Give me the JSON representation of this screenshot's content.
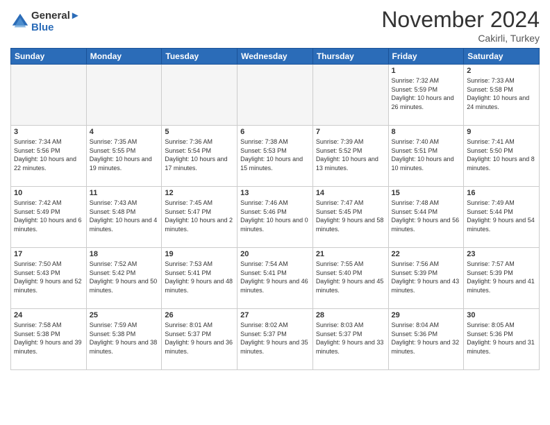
{
  "header": {
    "logo_line1": "General",
    "logo_line2": "Blue",
    "month": "November 2024",
    "location": "Cakirli, Turkey"
  },
  "weekdays": [
    "Sunday",
    "Monday",
    "Tuesday",
    "Wednesday",
    "Thursday",
    "Friday",
    "Saturday"
  ],
  "weeks": [
    [
      {
        "day": "",
        "empty": true
      },
      {
        "day": "",
        "empty": true
      },
      {
        "day": "",
        "empty": true
      },
      {
        "day": "",
        "empty": true
      },
      {
        "day": "",
        "empty": true
      },
      {
        "day": "1",
        "sunrise": "7:32 AM",
        "sunset": "5:59 PM",
        "daylight": "10 hours and 26 minutes."
      },
      {
        "day": "2",
        "sunrise": "7:33 AM",
        "sunset": "5:58 PM",
        "daylight": "10 hours and 24 minutes."
      }
    ],
    [
      {
        "day": "3",
        "sunrise": "7:34 AM",
        "sunset": "5:56 PM",
        "daylight": "10 hours and 22 minutes."
      },
      {
        "day": "4",
        "sunrise": "7:35 AM",
        "sunset": "5:55 PM",
        "daylight": "10 hours and 19 minutes."
      },
      {
        "day": "5",
        "sunrise": "7:36 AM",
        "sunset": "5:54 PM",
        "daylight": "10 hours and 17 minutes."
      },
      {
        "day": "6",
        "sunrise": "7:38 AM",
        "sunset": "5:53 PM",
        "daylight": "10 hours and 15 minutes."
      },
      {
        "day": "7",
        "sunrise": "7:39 AM",
        "sunset": "5:52 PM",
        "daylight": "10 hours and 13 minutes."
      },
      {
        "day": "8",
        "sunrise": "7:40 AM",
        "sunset": "5:51 PM",
        "daylight": "10 hours and 10 minutes."
      },
      {
        "day": "9",
        "sunrise": "7:41 AM",
        "sunset": "5:50 PM",
        "daylight": "10 hours and 8 minutes."
      }
    ],
    [
      {
        "day": "10",
        "sunrise": "7:42 AM",
        "sunset": "5:49 PM",
        "daylight": "10 hours and 6 minutes."
      },
      {
        "day": "11",
        "sunrise": "7:43 AM",
        "sunset": "5:48 PM",
        "daylight": "10 hours and 4 minutes."
      },
      {
        "day": "12",
        "sunrise": "7:45 AM",
        "sunset": "5:47 PM",
        "daylight": "10 hours and 2 minutes."
      },
      {
        "day": "13",
        "sunrise": "7:46 AM",
        "sunset": "5:46 PM",
        "daylight": "10 hours and 0 minutes."
      },
      {
        "day": "14",
        "sunrise": "7:47 AM",
        "sunset": "5:45 PM",
        "daylight": "9 hours and 58 minutes."
      },
      {
        "day": "15",
        "sunrise": "7:48 AM",
        "sunset": "5:44 PM",
        "daylight": "9 hours and 56 minutes."
      },
      {
        "day": "16",
        "sunrise": "7:49 AM",
        "sunset": "5:44 PM",
        "daylight": "9 hours and 54 minutes."
      }
    ],
    [
      {
        "day": "17",
        "sunrise": "7:50 AM",
        "sunset": "5:43 PM",
        "daylight": "9 hours and 52 minutes."
      },
      {
        "day": "18",
        "sunrise": "7:52 AM",
        "sunset": "5:42 PM",
        "daylight": "9 hours and 50 minutes."
      },
      {
        "day": "19",
        "sunrise": "7:53 AM",
        "sunset": "5:41 PM",
        "daylight": "9 hours and 48 minutes."
      },
      {
        "day": "20",
        "sunrise": "7:54 AM",
        "sunset": "5:41 PM",
        "daylight": "9 hours and 46 minutes."
      },
      {
        "day": "21",
        "sunrise": "7:55 AM",
        "sunset": "5:40 PM",
        "daylight": "9 hours and 45 minutes."
      },
      {
        "day": "22",
        "sunrise": "7:56 AM",
        "sunset": "5:39 PM",
        "daylight": "9 hours and 43 minutes."
      },
      {
        "day": "23",
        "sunrise": "7:57 AM",
        "sunset": "5:39 PM",
        "daylight": "9 hours and 41 minutes."
      }
    ],
    [
      {
        "day": "24",
        "sunrise": "7:58 AM",
        "sunset": "5:38 PM",
        "daylight": "9 hours and 39 minutes."
      },
      {
        "day": "25",
        "sunrise": "7:59 AM",
        "sunset": "5:38 PM",
        "daylight": "9 hours and 38 minutes."
      },
      {
        "day": "26",
        "sunrise": "8:01 AM",
        "sunset": "5:37 PM",
        "daylight": "9 hours and 36 minutes."
      },
      {
        "day": "27",
        "sunrise": "8:02 AM",
        "sunset": "5:37 PM",
        "daylight": "9 hours and 35 minutes."
      },
      {
        "day": "28",
        "sunrise": "8:03 AM",
        "sunset": "5:37 PM",
        "daylight": "9 hours and 33 minutes."
      },
      {
        "day": "29",
        "sunrise": "8:04 AM",
        "sunset": "5:36 PM",
        "daylight": "9 hours and 32 minutes."
      },
      {
        "day": "30",
        "sunrise": "8:05 AM",
        "sunset": "5:36 PM",
        "daylight": "9 hours and 31 minutes."
      }
    ]
  ]
}
